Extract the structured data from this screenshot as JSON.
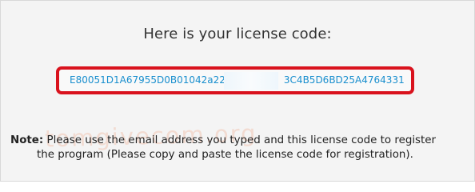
{
  "license": {
    "heading": "Here is your license code:",
    "code_visible_start": "E80051D1A67955D0B01042a22",
    "code_visible_end": "3C4B5D6BD25A4764331"
  },
  "note": {
    "prefix": "Note:",
    "line1": " Please use the email address you typed and this license code to register",
    "line2": "the program (Please copy and paste the license code for registration)."
  },
  "watermark": {
    "text": "tomgivecom.org"
  },
  "colors": {
    "highlight_border": "#d9121d",
    "code_text": "#1a8fce",
    "panel_background": "#f4f4f4"
  }
}
